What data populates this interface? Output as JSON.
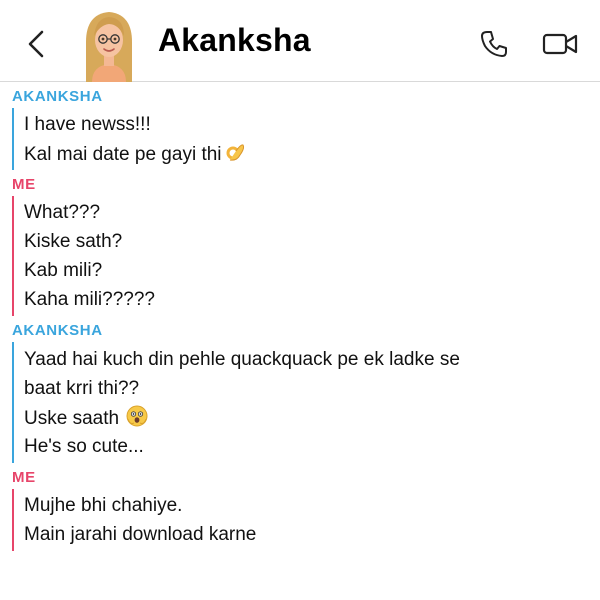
{
  "header": {
    "contact_name": "Akanksha",
    "icons": [
      "back-chevron-icon",
      "bitmoji-avatar",
      "phone-icon",
      "video-camera-icon"
    ]
  },
  "colors": {
    "friend": "#3aa5dd",
    "me": "#e7456a",
    "divider": "#d9d9d9"
  },
  "chat": {
    "groups": [
      {
        "sender": "AKANKSHA",
        "messages": [
          "I have newss!!!",
          "Kal mai date pe gayi thi"
        ]
      },
      {
        "sender": "ME",
        "messages": [
          "What???",
          "Kiske sath?",
          "Kab mili?",
          "Kaha mili?????"
        ]
      },
      {
        "sender": "AKANKSHA",
        "messages": [
          "Yaad hai kuch din pehle quackquack pe ek ladke se baat krri thi??",
          "Uske saath",
          "He's so cute..."
        ]
      },
      {
        "sender": "ME",
        "messages": [
          "Mujhe bhi chahiye.",
          "Main jarahi download karne"
        ]
      }
    ],
    "emojis": [
      "ok-hand-emoji",
      "shocked-face-emoji"
    ]
  }
}
